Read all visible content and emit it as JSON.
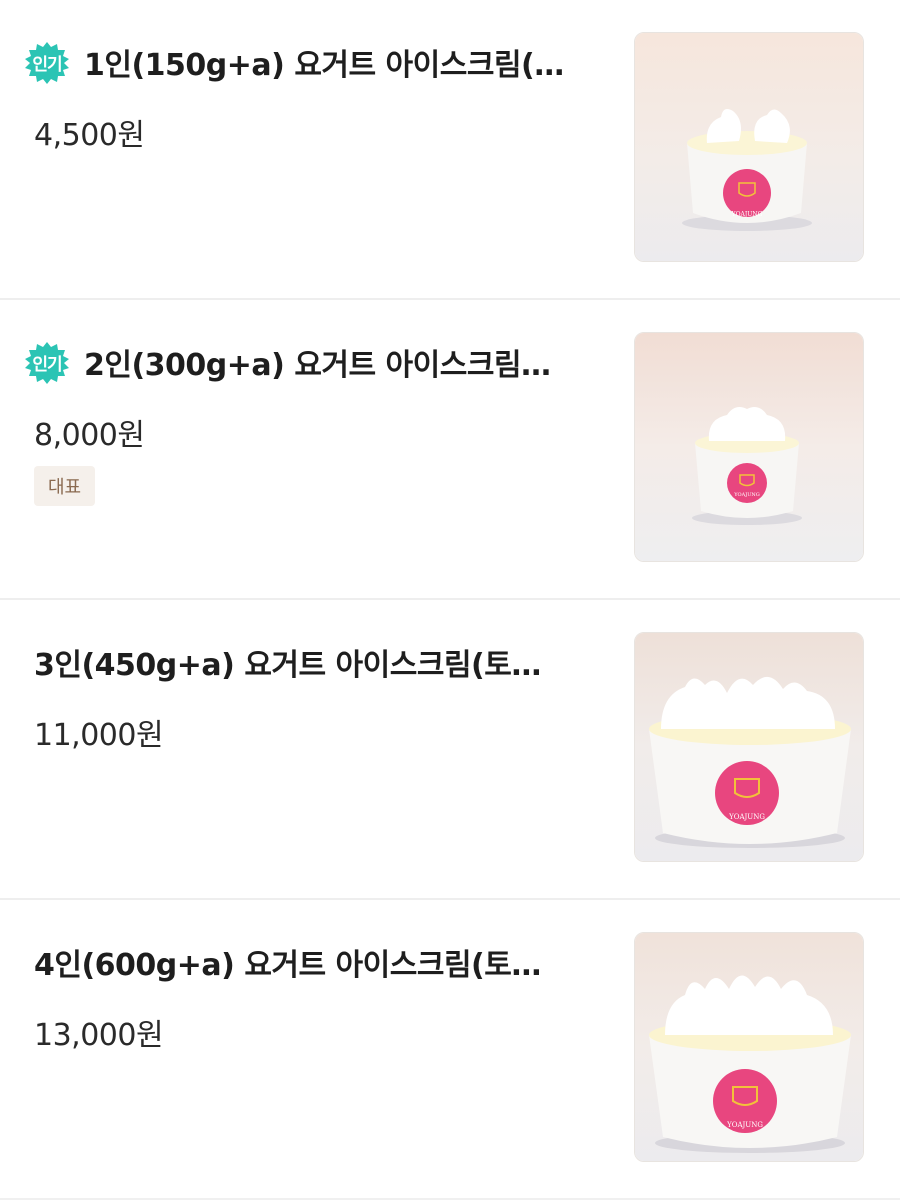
{
  "menu": {
    "items": [
      {
        "badge": "인기",
        "title": "1인(150g+a) 요거트 아이스크림(…",
        "price": "4,500원",
        "tag": "",
        "image": "yogurt-cup-1-person",
        "brand": "YOAJUNG"
      },
      {
        "badge": "인기",
        "title": "2인(300g+a) 요거트 아이스크림…",
        "price": "8,000원",
        "tag": "대표",
        "image": "yogurt-cup-2-person",
        "brand": "YOAJUNG"
      },
      {
        "badge": "",
        "title": "3인(450g+a) 요거트 아이스크림(토…",
        "price": "11,000원",
        "tag": "",
        "image": "yogurt-cup-3-person",
        "brand": "YOAJUNG"
      },
      {
        "badge": "",
        "title": "4인(600g+a) 요거트 아이스크림(토…",
        "price": "13,000원",
        "tag": "",
        "image": "yogurt-cup-4-person",
        "brand": "YOAJUNG"
      }
    ]
  },
  "colors": {
    "badge": "#2bc4b4",
    "tag_bg": "#f5f0eb",
    "tag_text": "#8a6a50",
    "logo_pink": "#e8467f"
  }
}
